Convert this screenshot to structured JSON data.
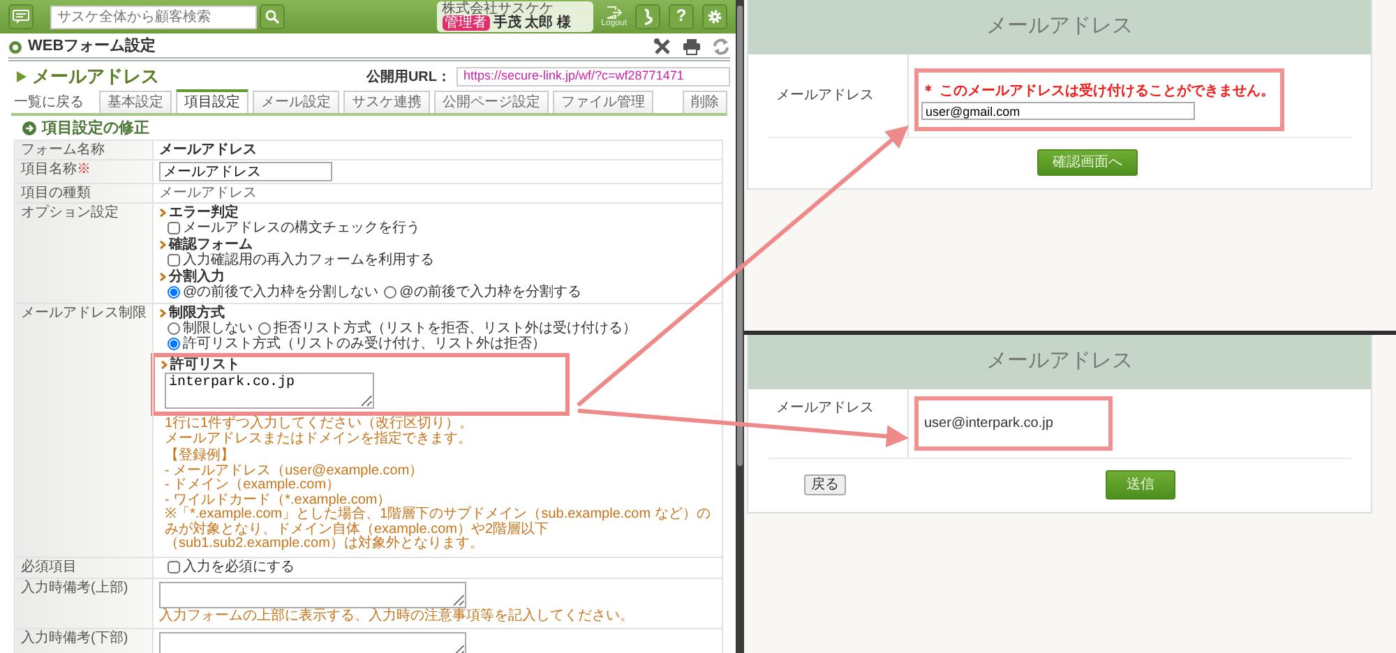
{
  "header": {
    "search": {
      "placeholder": "サスケ全体から顧客検索"
    },
    "user": {
      "company": "株式会社サスケケ",
      "role_badge": "管理者",
      "name": "手茂 太郎 様"
    },
    "logout_label": "Logout",
    "help_label": "?"
  },
  "page_title": "WEBフォーム設定",
  "form_title": "メールアドレス",
  "public_url": {
    "label": "公開用URL：",
    "value": "https://secure-link.jp/wf/?c=wf28771471"
  },
  "back_link": "一覧に戻る",
  "tabs": [
    {
      "label": "基本設定",
      "selected": false
    },
    {
      "label": "項目設定",
      "selected": true
    },
    {
      "label": "メール設定",
      "selected": false
    },
    {
      "label": "サスケ連携",
      "selected": false
    },
    {
      "label": "公開ページ設定",
      "selected": false
    },
    {
      "label": "ファイル管理",
      "selected": false
    }
  ],
  "delete_button": "削除",
  "section_title": "項目設定の修正",
  "rows": [
    {
      "kind": "strong",
      "label": "フォーム名称",
      "value": "メールアドレス"
    },
    {
      "kind": "input",
      "label": "項目名称",
      "required_mark": "※",
      "value": "メールアドレス"
    },
    {
      "kind": "plain",
      "label": "項目の種類",
      "value": "メールアドレス"
    },
    {
      "kind": "options",
      "label": "オプション設定",
      "groups": [
        {
          "title": "エラー判定",
          "choices": [
            {
              "kind": "checkbox",
              "label": "メールアドレスの構文チェックを行う",
              "checked": false
            }
          ]
        },
        {
          "title": "確認フォーム",
          "choices": [
            {
              "kind": "checkbox",
              "label": "入力確認用の再入力フォームを利用する",
              "checked": false
            }
          ]
        },
        {
          "title": "分割入力",
          "choices": [
            {
              "kind": "radio",
              "label": "@の前後で入力枠を分割しない",
              "selected": true
            },
            {
              "kind": "radio",
              "label": "@の前後で入力枠を分割する",
              "selected": false
            }
          ]
        }
      ]
    },
    {
      "kind": "options",
      "label": "メールアドレス制限",
      "groups": [
        {
          "title": "制限方式",
          "choices": [
            {
              "kind": "radio",
              "label": "制限しない",
              "selected": false
            },
            {
              "kind": "radio",
              "label": "拒否リスト方式（リストを拒否、リスト外は受け付ける）",
              "selected": false
            },
            {
              "kind": "radio",
              "label": "許可リスト方式（リストのみ受け付け、リスト外は拒否）",
              "selected": true
            }
          ]
        },
        {
          "title": "許可リスト",
          "highlighted": true,
          "textarea": "interpark.co.jp",
          "help": [
            [
              "1行に1件ずつ入力してください（改行区切り）。",
              "メールアドレスまたはドメインを指定できます。"
            ],
            [
              "【登録例】",
              "- メールアドレス（user@example.com）",
              "- ドメイン（example.com）",
              "- ワイルドカード（*.example.com）",
              "※「*.example.com」とした場合、1階層下のサブドメイン（sub.example.com など）のみが対象となり、ドメイン自体（example.com）や2階層以下（sub1.sub2.example.com）は対象外となります。"
            ]
          ]
        }
      ]
    },
    {
      "kind": "options",
      "label": "必須項目",
      "groups": [
        {
          "choices": [
            {
              "kind": "checkbox",
              "label": "入力を必須にする",
              "checked": false
            }
          ]
        }
      ]
    },
    {
      "kind": "textarea",
      "label": "入力時備考(上部)",
      "help": [
        [
          "入力フォームの上部に表示する、入力時の注意事項等を記入してください。"
        ]
      ]
    },
    {
      "kind": "textarea",
      "label": "入力時備考(下部)"
    }
  ],
  "previews": [
    {
      "title": "メールアドレス",
      "field_label": "メールアドレス",
      "kind": "input",
      "highlighted": true,
      "error": "＊ このメールアドレスは受け付けることができません。",
      "value": "user@gmail.com",
      "buttons": [
        {
          "kind": "primary",
          "label": "確認画面へ"
        }
      ]
    },
    {
      "title": "メールアドレス",
      "field_label": "メールアドレス",
      "kind": "confirm",
      "highlighted": true,
      "value": "user@interpark.co.jp",
      "buttons": [
        {
          "kind": "secondary",
          "label": "戻る"
        },
        {
          "kind": "primary",
          "label": "送信"
        }
      ]
    }
  ]
}
